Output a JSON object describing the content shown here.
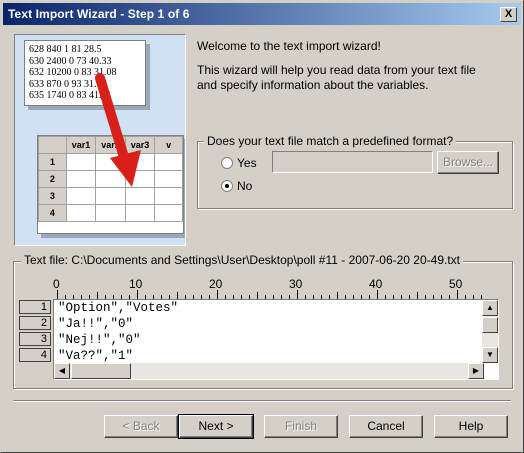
{
  "window": {
    "title": "Text Import Wizard - Step 1 of 6",
    "close_label": "X"
  },
  "illustration": {
    "data_lines": [
      "628 840 1 81 28.5",
      "630 2400 0 73 40.33",
      "632 10200 0 83 31.08",
      "633 870 0 93 31.17",
      "635 1740 0 83 41.91"
    ],
    "columns": [
      "var1",
      "var2",
      "var3",
      "v"
    ],
    "rows": [
      "1",
      "2",
      "3",
      "4"
    ]
  },
  "welcome": "Welcome to the text import wizard!",
  "description": "This wizard will help you read data from your text file and specify information about the variables.",
  "format_group": {
    "label": "Does your text file match a predefined format?",
    "yes_label": "Yes",
    "no_label": "No",
    "selected": "No",
    "browse_label": "Browse..."
  },
  "text_file": {
    "label": "Text file: C:\\Documents and Settings\\User\\Desktop\\poll #11 - 2007-06-20 20-49.txt",
    "ruler_ticks": [
      "0",
      "10",
      "20",
      "30",
      "40",
      "50"
    ],
    "row_numbers": [
      "1",
      "2",
      "3",
      "4"
    ],
    "lines": [
      "\"Option\",\"Votes\"",
      "\"Ja!!\",\"0\"",
      "\"Nej!!\",\"0\"",
      "\"Va??\",\"1\""
    ]
  },
  "buttons": {
    "back": "< Back",
    "next": "Next >",
    "finish": "Finish",
    "cancel": "Cancel",
    "help": "Help"
  },
  "colors": {
    "title_start": "#0a246a",
    "title_end": "#a6caf0",
    "arrow": "#d7201a",
    "face": "#d4d0c8"
  }
}
